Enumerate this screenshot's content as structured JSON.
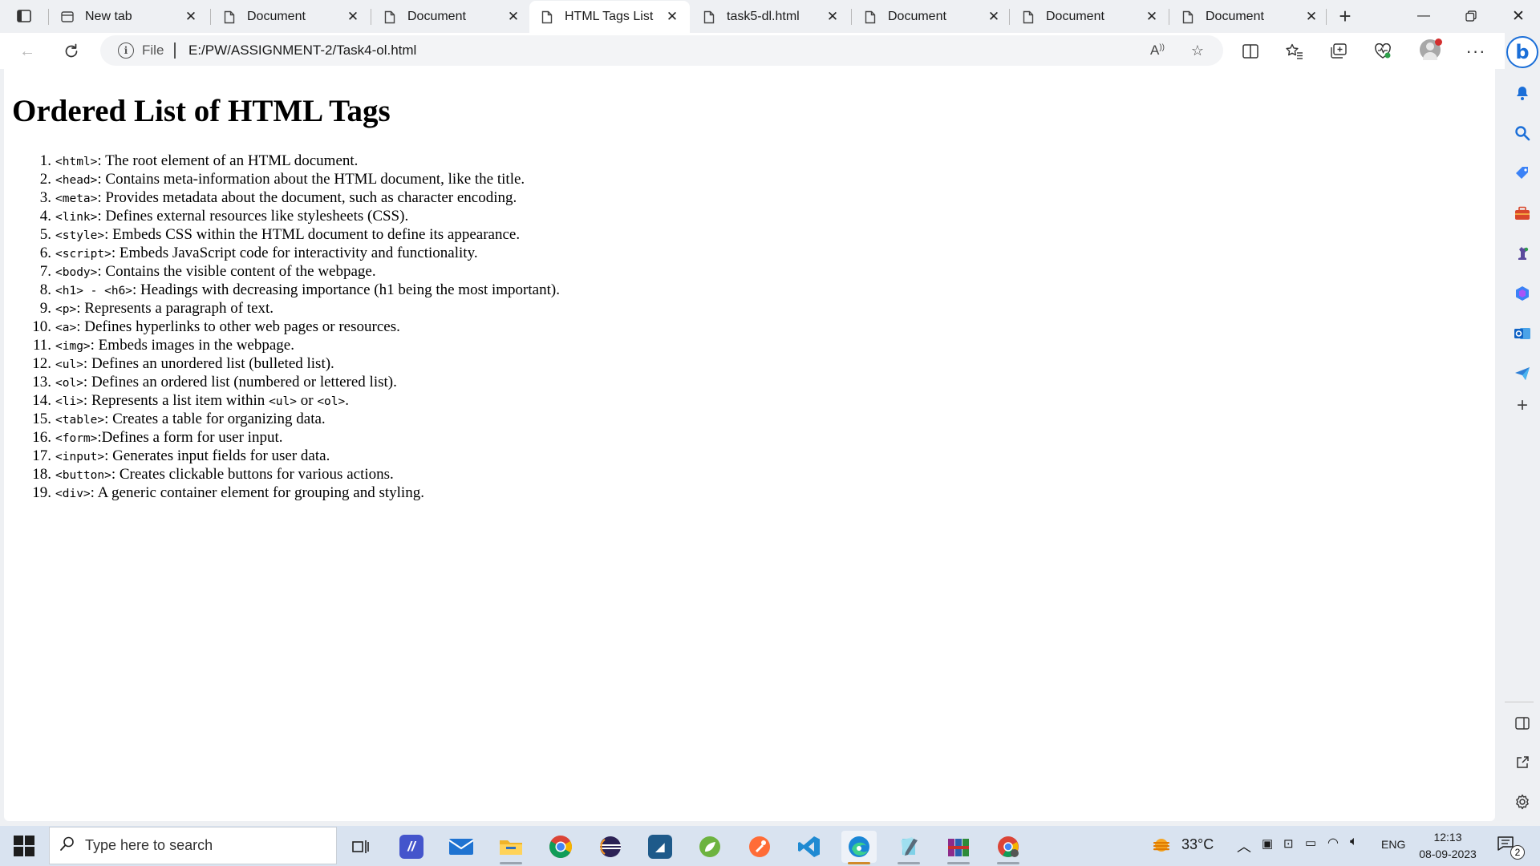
{
  "tabs": [
    {
      "title": "New tab",
      "icon": "newtab-icon"
    },
    {
      "title": "Document",
      "icon": "document-icon"
    },
    {
      "title": "Document",
      "icon": "document-icon"
    },
    {
      "title": "HTML Tags List",
      "icon": "document-icon",
      "active": true
    },
    {
      "title": "task5-dl.html",
      "icon": "document-icon"
    },
    {
      "title": "Document",
      "icon": "document-icon"
    },
    {
      "title": "Document",
      "icon": "document-icon"
    },
    {
      "title": "Document",
      "icon": "document-icon"
    }
  ],
  "address_bar": {
    "scheme_label": "File",
    "url": "E:/PW/ASSIGNMENT-2/Task4-ol.html"
  },
  "page": {
    "heading": "Ordered List of HTML Tags",
    "items": [
      {
        "num": "1.",
        "parts": [
          {
            "code": "<html>"
          },
          {
            "text": ": The root element of an HTML document."
          }
        ]
      },
      {
        "num": "2.",
        "parts": [
          {
            "code": "<head>"
          },
          {
            "text": ": Contains meta-information about the HTML document, like the title."
          }
        ]
      },
      {
        "num": "3.",
        "parts": [
          {
            "code": "<meta>"
          },
          {
            "text": ": Provides metadata about the document, such as character encoding."
          }
        ]
      },
      {
        "num": "4.",
        "parts": [
          {
            "code": "<link>"
          },
          {
            "text": ": Defines external resources like stylesheets (CSS)."
          }
        ]
      },
      {
        "num": "5.",
        "parts": [
          {
            "code": "<style>"
          },
          {
            "text": ": Embeds CSS within the HTML document to define its appearance."
          }
        ]
      },
      {
        "num": "6.",
        "parts": [
          {
            "code": "<script>"
          },
          {
            "text": ": Embeds JavaScript code for interactivity and functionality."
          }
        ]
      },
      {
        "num": "7.",
        "parts": [
          {
            "code": "<body>"
          },
          {
            "text": ": Contains the visible content of the webpage."
          }
        ]
      },
      {
        "num": "8.",
        "parts": [
          {
            "code": "<h1> - <h6>"
          },
          {
            "text": ": Headings with decreasing importance (h1 being the most important)."
          }
        ]
      },
      {
        "num": "9.",
        "parts": [
          {
            "code": "<p>"
          },
          {
            "text": ": Represents a paragraph of text."
          }
        ]
      },
      {
        "num": "10.",
        "parts": [
          {
            "code": "<a>"
          },
          {
            "text": ": Defines hyperlinks to other web pages or resources."
          }
        ]
      },
      {
        "num": "11.",
        "parts": [
          {
            "code": "<img>"
          },
          {
            "text": ": Embeds images in the webpage."
          }
        ]
      },
      {
        "num": "12.",
        "parts": [
          {
            "code": "<ul>"
          },
          {
            "text": ": Defines an unordered list (bulleted list)."
          }
        ]
      },
      {
        "num": "13.",
        "parts": [
          {
            "code": "<ol>"
          },
          {
            "text": ": Defines an ordered list (numbered or lettered list)."
          }
        ]
      },
      {
        "num": "14.",
        "parts": [
          {
            "code": "<li>"
          },
          {
            "text": ": Represents a list item within "
          },
          {
            "code": "<ul>"
          },
          {
            "text": " or "
          },
          {
            "code": "<ol>"
          },
          {
            "text": "."
          }
        ]
      },
      {
        "num": "15.",
        "parts": [
          {
            "code": "<table>"
          },
          {
            "text": ": Creates a table for organizing data."
          }
        ]
      },
      {
        "num": "16.",
        "parts": [
          {
            "code": "<form>"
          },
          {
            "text": ":Defines a form for user input."
          }
        ]
      },
      {
        "num": "17.",
        "parts": [
          {
            "code": "<input>"
          },
          {
            "text": ": Generates input fields for user data."
          }
        ]
      },
      {
        "num": "18.",
        "parts": [
          {
            "code": "<button>"
          },
          {
            "text": ": Creates clickable buttons for various actions."
          }
        ]
      },
      {
        "num": "19.",
        "parts": [
          {
            "code": "<div>"
          },
          {
            "text": ": A generic container element for grouping and styling."
          }
        ]
      }
    ]
  },
  "taskbar": {
    "search_placeholder": "Type here to search",
    "weather": "33°C",
    "language": "ENG",
    "time": "12:13",
    "date": "08-09-2023",
    "notification_count": "2"
  },
  "colors": {
    "accent": "#1b6fd8",
    "chrome_bg": "#eef0f3",
    "taskbar_bg": "#d9e3f0"
  }
}
